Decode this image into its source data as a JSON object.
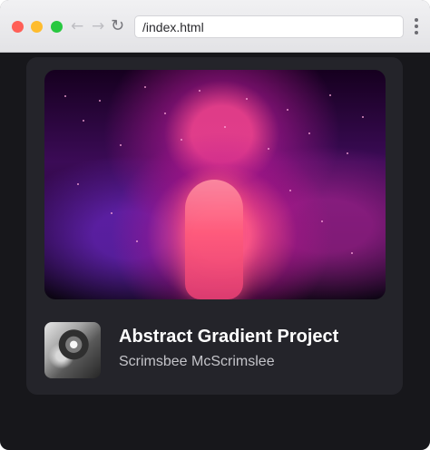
{
  "browser": {
    "address": "/index.html",
    "nav_icons": {
      "back": "back-arrow-icon",
      "forward": "forward-arrow-icon",
      "reload": "reload-icon",
      "menu": "more-options-icon"
    },
    "traffic_colors": {
      "close": "#ff5f57",
      "minimize": "#febc2e",
      "zoom": "#28c840"
    }
  },
  "card": {
    "title": "Abstract Gradient Project",
    "author": "Scrimsbee McScrimslee"
  }
}
